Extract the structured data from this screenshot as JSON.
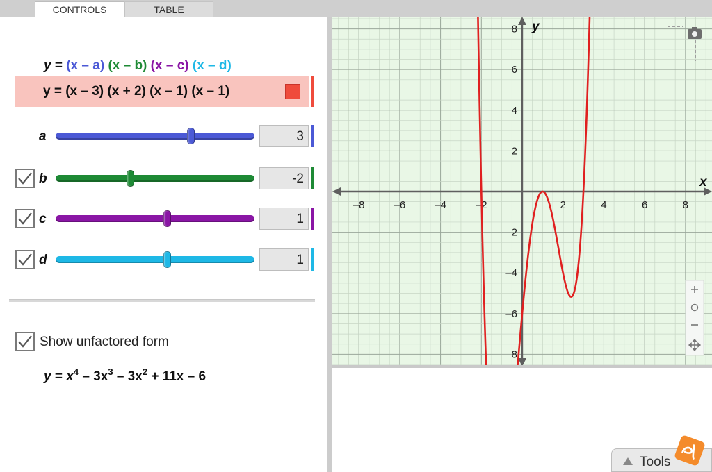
{
  "tabs": [
    {
      "label": "CONTROLS",
      "active": true
    },
    {
      "label": "TABLE",
      "active": false
    }
  ],
  "formula_generic": {
    "y": "y",
    "eq": " = ",
    "fa": "(x – a)",
    "fb": "(x – b)",
    "fc": "(x – c)",
    "fd": "(x – d)"
  },
  "formula_current": "y = (x – 3) (x + 2) (x – 1) (x – 1)",
  "params": [
    {
      "name": "a",
      "value": "3",
      "fraction": 0.68,
      "color": "#4b59d6",
      "has_checkbox": false,
      "checked": false
    },
    {
      "name": "b",
      "value": "-2",
      "fraction": 0.375,
      "color": "#1e8a35",
      "has_checkbox": true,
      "checked": true
    },
    {
      "name": "c",
      "value": "1",
      "fraction": 0.56,
      "color": "#8a16a5",
      "has_checkbox": true,
      "checked": true
    },
    {
      "name": "d",
      "value": "1",
      "fraction": 0.56,
      "color": "#1eb8e6",
      "has_checkbox": true,
      "checked": true
    }
  ],
  "unfactored": {
    "label": "Show unfactored form",
    "checked": true,
    "y": "y",
    "eq": " = ",
    "t1": "x",
    "e1": "4",
    "t2": " – 3x",
    "e2": "3",
    "t3": " – 3x",
    "e3": "2",
    "t4": " + 11x – 6"
  },
  "colors": {
    "curve": "#e02020",
    "grid_bg": "#e9f7e6",
    "accent_red": "#ef4b3c"
  },
  "graph": {
    "x_label": "x",
    "y_label": "y",
    "x_ticks": [
      "–8",
      "–6",
      "–4",
      "–2",
      "2",
      "4",
      "6",
      "8"
    ],
    "y_ticks": [
      "8",
      "6",
      "4",
      "2",
      "–2",
      "–4",
      "–6",
      "–8"
    ],
    "x_range": [
      -9.3,
      9.3
    ],
    "y_range": [
      -8.6,
      8.6
    ],
    "roots": [
      3,
      -2,
      1,
      1
    ]
  },
  "toolbar_icons": [
    "camera-icon",
    "zoom-in-icon",
    "reset-view-icon",
    "zoom-out-icon",
    "pan-icon"
  ],
  "tools_button": {
    "label": "Tools"
  }
}
